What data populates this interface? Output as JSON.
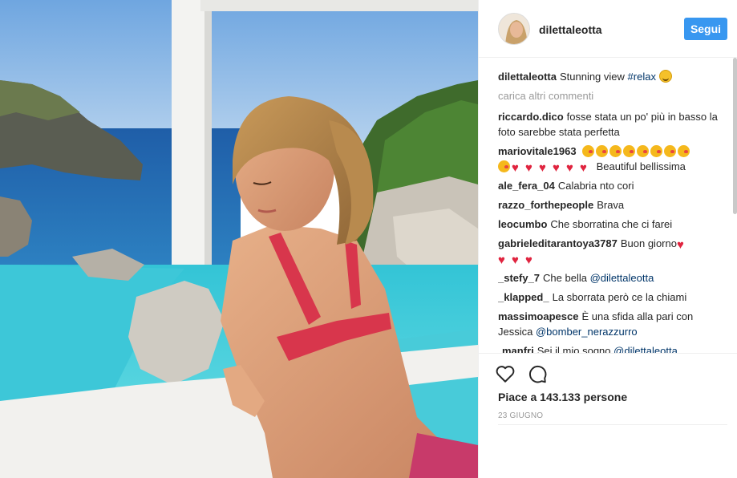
{
  "header": {
    "username": "dilettaleotta",
    "follow_label": "Segui"
  },
  "caption": {
    "user": "dilettaleotta",
    "text": "Stunning view",
    "hashtag": "#relax"
  },
  "load_more": "carica altri commenti",
  "comments": [
    {
      "user": "riccardo.dico",
      "text": "fosse stata un po' più in basso la foto sarebbe stata perfetta"
    },
    {
      "user": "mariovitale1963",
      "text": "Beautiful bellissima"
    },
    {
      "user": "ale_fera_04",
      "text": "Calabria nto cori"
    },
    {
      "user": "razzo_forthepeople",
      "text": "Brava"
    },
    {
      "user": "leocumbo",
      "text": "Che sborratina che ci farei"
    },
    {
      "user": "gabrieleditarantoya3787",
      "text": "Buon giorno"
    },
    {
      "user": "_stefy_7",
      "text": "Che bella",
      "mention": "@dilettaleotta"
    },
    {
      "user": "_klapped_",
      "text": "La sborrata però ce la chiami"
    },
    {
      "user": "massimoapesce",
      "text": "È una sfida alla pari con Jessica",
      "mention": "@bomber_nerazzurro"
    },
    {
      "user": "manfri",
      "text": "Sei il mio sogno",
      "mention": "@dilettaleotta"
    }
  ],
  "likes": "Piace a 143.133 persone",
  "date": "23 GIUGNO",
  "icons": [
    "heart-icon",
    "comment-icon",
    "smile-emoji",
    "kiss-emoji",
    "red-heart-emoji"
  ],
  "colors": {
    "accent": "#3897f0",
    "link": "#003569",
    "muted": "#999999",
    "heart": "#e0243f"
  }
}
